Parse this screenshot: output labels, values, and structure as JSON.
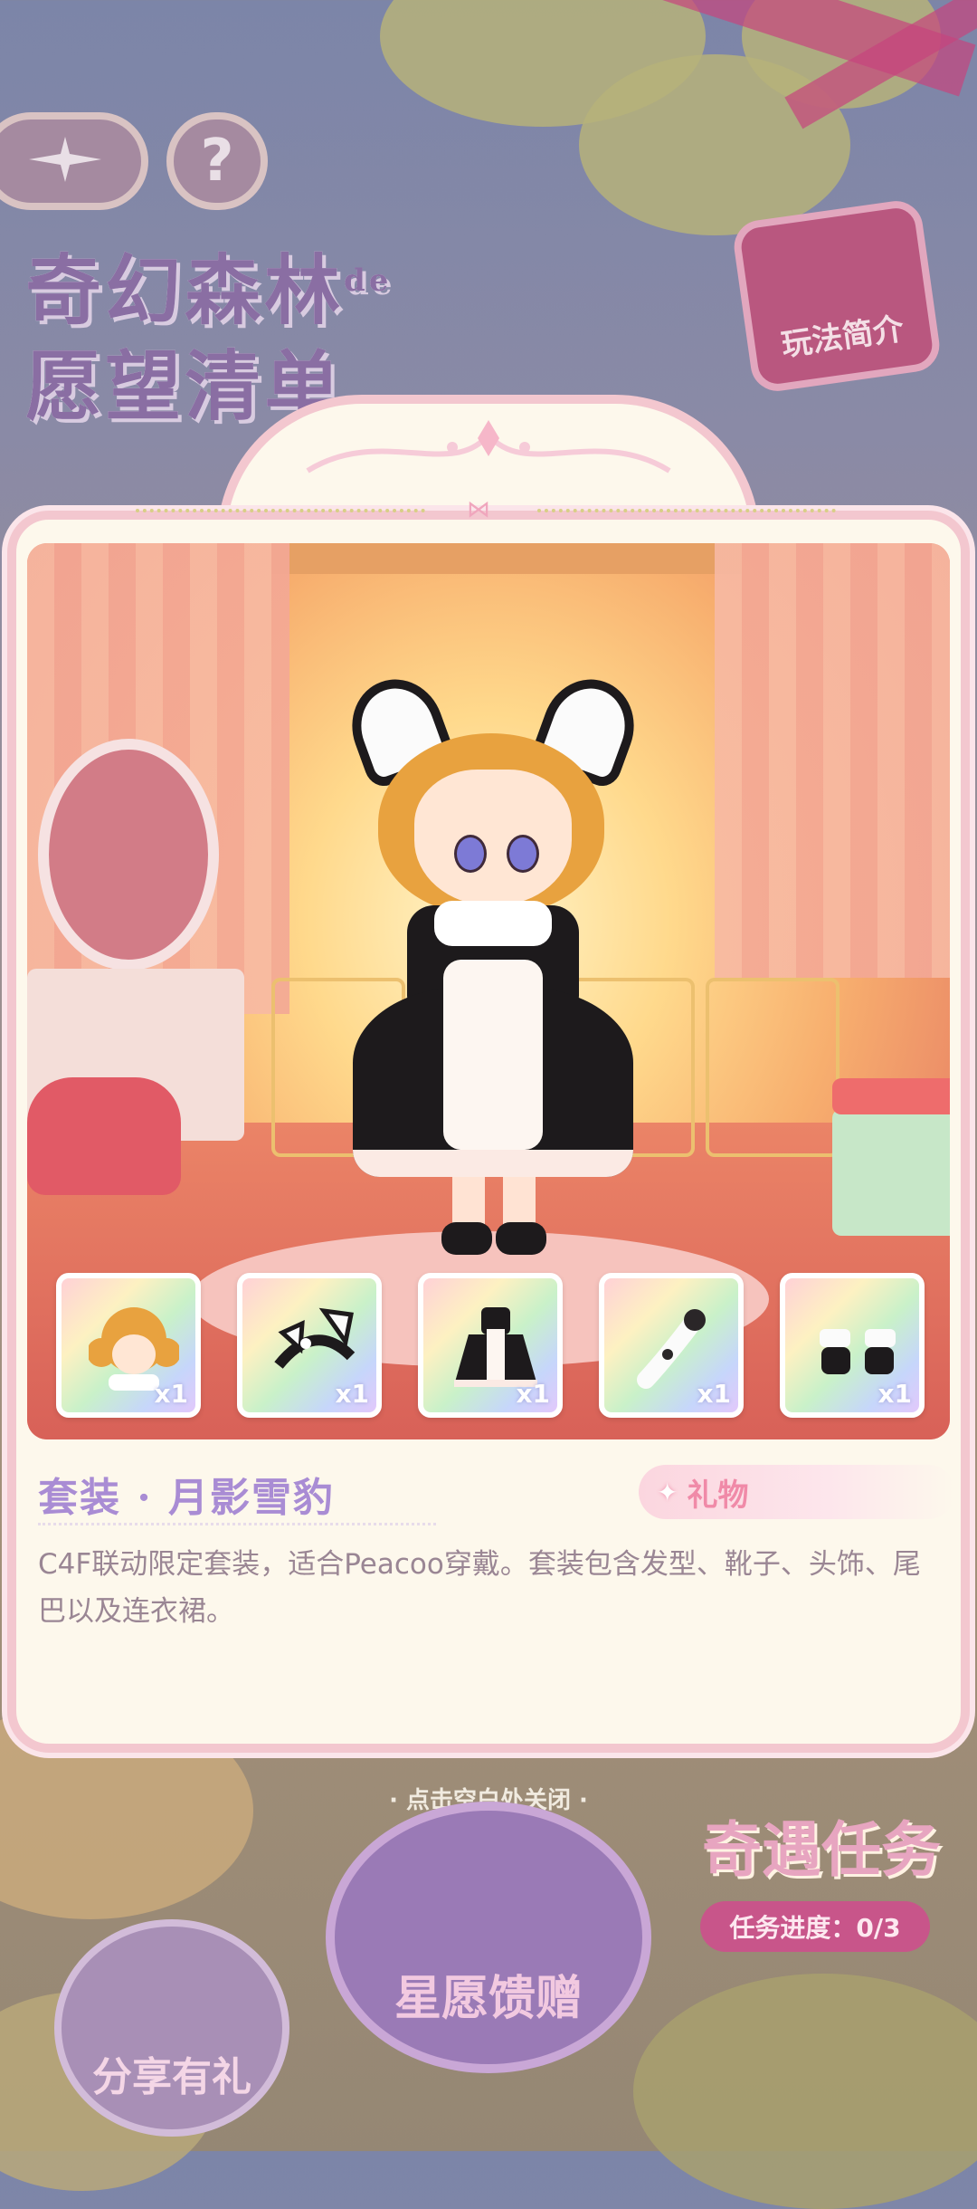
{
  "header": {
    "back_icon": "compass-star-icon",
    "help_label": "?",
    "game_title_line1": "奇幻森林",
    "game_title_suffix": "de",
    "game_title_line2": "愿望清单",
    "intro_button_label": "玩法简介"
  },
  "dialog": {
    "items": [
      {
        "name": "hairstyle",
        "icon": "hair-icon",
        "qty": "x1"
      },
      {
        "name": "headband",
        "icon": "headband-icon",
        "qty": "x1"
      },
      {
        "name": "dress",
        "icon": "dress-icon",
        "qty": "x1"
      },
      {
        "name": "tail",
        "icon": "tail-icon",
        "qty": "x1"
      },
      {
        "name": "boots",
        "icon": "boots-icon",
        "qty": "x1"
      }
    ],
    "set_title": "套装 · 月影雪豹",
    "gift_tag": "礼物",
    "description": "C4F联动限定套装，适合Peacoo穿戴。套装包含发型、靴子、头饰、尾巴以及连衣裙。"
  },
  "footer": {
    "close_hint": "· 点击空白处关闭 ·",
    "task_title": "奇遇任务",
    "task_progress": "任务进度：0/3",
    "star_wish_label": "星愿馈赠",
    "share_label": "分享有礼"
  },
  "colors": {
    "dialog_bg": "#fdf8ec",
    "dialog_border": "#f3c7cf",
    "title_purple": "#a98cd4",
    "gift_pink": "#f08aa8",
    "desc_text": "#9a8694",
    "task_bg": "#c8558a"
  }
}
